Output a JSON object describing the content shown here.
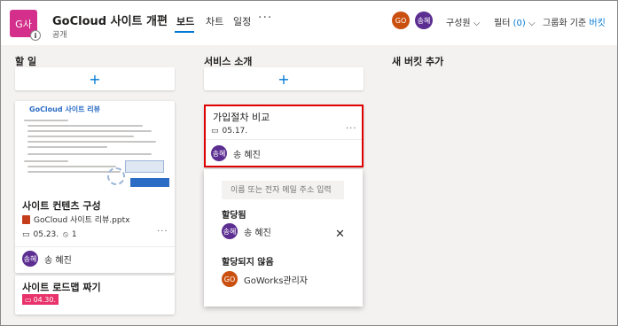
{
  "header": {
    "plan_initials": "G사",
    "plan_title": "GoCloud 사이트 개편",
    "plan_visibility": "공개",
    "tabs": [
      "보드",
      "차트",
      "일정"
    ],
    "more": "···",
    "members_label": "구성원",
    "filter_label": "필터",
    "filter_count": "(0)",
    "group_label": "그룹화 기준",
    "group_value": "버킷",
    "avatars": [
      {
        "initials": "GO",
        "color": "#ca5010"
      },
      {
        "initials": "송혜",
        "color": "#5c2e91"
      }
    ]
  },
  "columns": [
    {
      "title": "할 일",
      "add": "+"
    },
    {
      "title": "서비스 소개",
      "add": "+"
    },
    {
      "title": "새 버킷 추가"
    }
  ],
  "cards": {
    "site_contents": {
      "preview_title": "GoCloud 사이트 리뷰",
      "title": "사이트 컨텐츠 구성",
      "attachment": "GoCloud 사이트 리뷰.pptx",
      "due": "05.23.",
      "attach_count": "1",
      "more": "···",
      "assignee": {
        "initials": "송혜",
        "name": "송 혜진"
      }
    },
    "roadmap": {
      "title": "사이트 로드맵 짜기",
      "due": "04.30."
    },
    "signup": {
      "title": "가입절차 비교",
      "due": "05.17.",
      "more": "···",
      "assignee": {
        "initials": "송혜",
        "name": "송 혜진"
      }
    }
  },
  "assign_popup": {
    "search_placeholder": "이름 또는 전자 메일 주소 입력",
    "assigned_label": "할당됨",
    "assigned": {
      "initials": "송혜",
      "name": "송 혜진",
      "color": "#5c2e91"
    },
    "unassigned_label": "할당되지 않음",
    "unassigned": {
      "initials": "GO",
      "name": "GoWorks관리자",
      "color": "#ca5010"
    }
  }
}
